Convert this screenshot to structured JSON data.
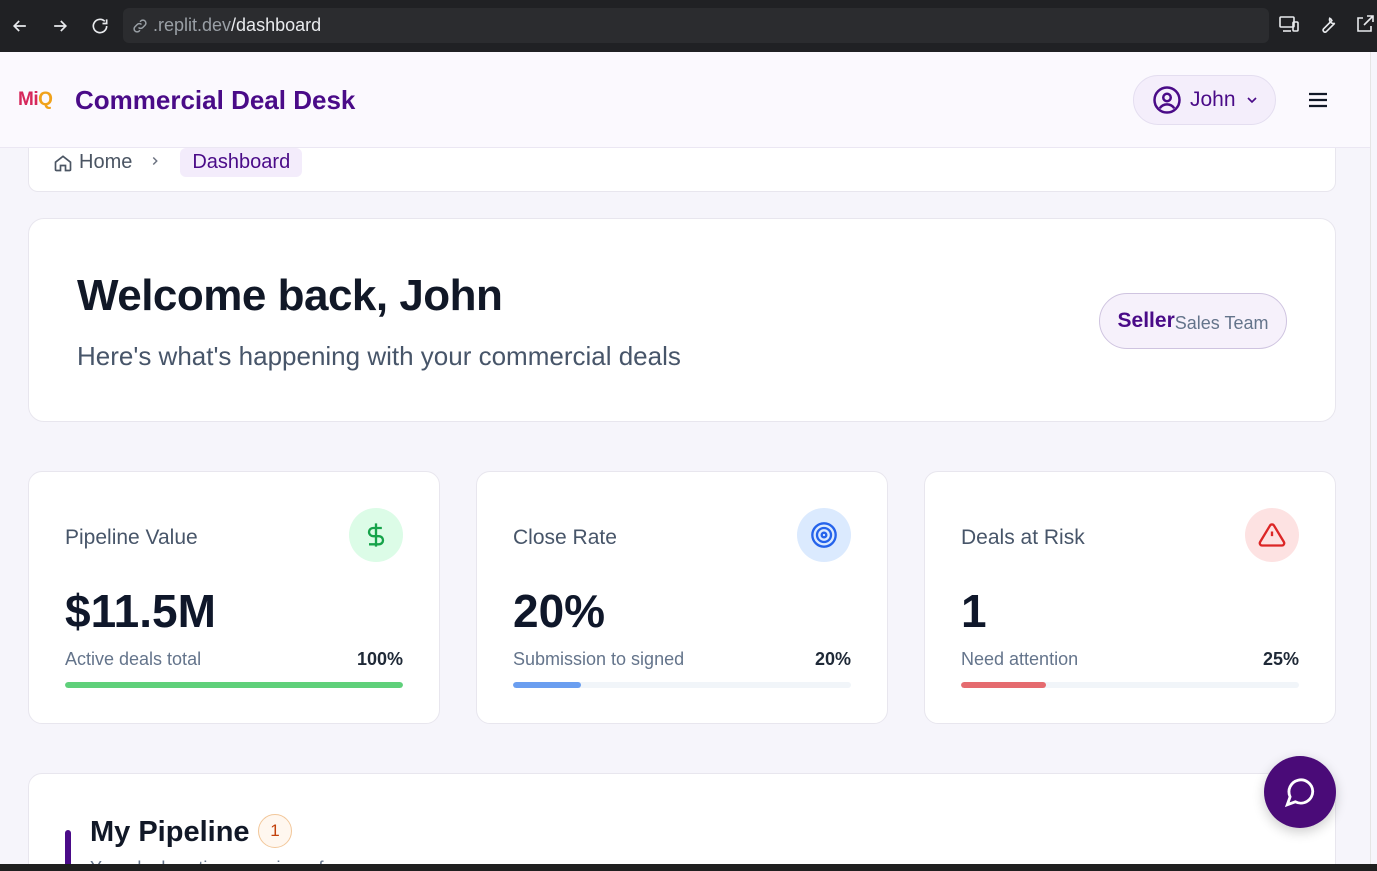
{
  "browser": {
    "url_host": ".replit.dev",
    "url_path": "/dashboard"
  },
  "header": {
    "logo_part1": "Mi",
    "logo_part2": "Q",
    "title": "Commercial Deal Desk",
    "user_name": "John"
  },
  "breadcrumb": {
    "home": "Home",
    "current": "Dashboard"
  },
  "welcome": {
    "heading": "Welcome back, John",
    "subtitle": "Here's what's happening with your commercial deals",
    "role": "Seller",
    "team": "Sales Team"
  },
  "stats": [
    {
      "label": "Pipeline Value",
      "value": "$11.5M",
      "sub": "Active deals total",
      "pct": "100%",
      "progress": 1.0,
      "icon": "dollar-icon",
      "color": "#5fd07a",
      "icon_bg": "#dcfce7",
      "icon_color": "#16a34a"
    },
    {
      "label": "Close Rate",
      "value": "20%",
      "sub": "Submission to signed",
      "pct": "20%",
      "progress": 0.2,
      "icon": "target-icon",
      "color": "#6a9ef0",
      "icon_bg": "#dbeafe",
      "icon_color": "#2563eb"
    },
    {
      "label": "Deals at Risk",
      "value": "1",
      "sub": "Need attention",
      "pct": "25%",
      "progress": 0.25,
      "icon": "alert-triangle-icon",
      "color": "#e56b6f",
      "icon_bg": "#fde2e2",
      "icon_color": "#dc2626"
    }
  ],
  "pipeline": {
    "title": "My Pipeline",
    "count": "1",
    "description": "Your deals action overview of"
  },
  "colors": {
    "brand": "#4a0b88",
    "chat_fab": "#4a0b78"
  }
}
